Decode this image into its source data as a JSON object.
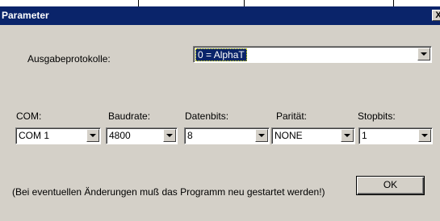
{
  "window": {
    "title": "Parameter",
    "close_glyph": "X"
  },
  "protocol": {
    "label": "Ausgabeprotokolle:",
    "value": "0 = AlphaT"
  },
  "fields": [
    {
      "label": "COM:",
      "value": "COM 1"
    },
    {
      "label": "Baudrate:",
      "value": "4800"
    },
    {
      "label": "Datenbits:",
      "value": "8"
    },
    {
      "label": "Parität:",
      "value": "NONE"
    },
    {
      "label": "Stopbits:",
      "value": "1"
    }
  ],
  "notice": "(Bei eventuellen Änderungen muß das Programm neu gestartet werden!)",
  "ok_label": "OK",
  "colors": {
    "titlebar": "#0a246a",
    "face": "#d4d0c8",
    "highlight": "#0a246a"
  },
  "icons": {
    "dropdown": "chevron-down-icon"
  }
}
